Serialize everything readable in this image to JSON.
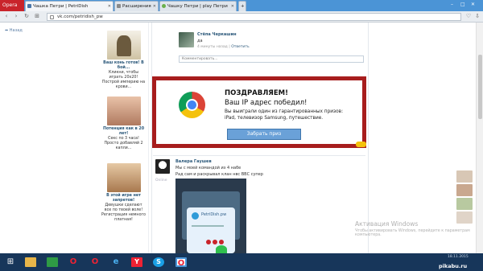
{
  "browser": {
    "opera_label": "Opera",
    "tabs": [
      {
        "label": "Чашка Петри | PetriDish"
      },
      {
        "label": "Расширения"
      },
      {
        "label": "Чашку Петри | play Петри"
      }
    ],
    "url": "vk.com/petridish_pw"
  },
  "sidebar": {
    "link": "Назад"
  },
  "ads": [
    {
      "title": "Ваш конь готов! В бой...",
      "text": "Кликни, чтобы играть 20x20! Построй империю на крови..."
    },
    {
      "title": "Потенция как в 20 лет!",
      "text": "Секс по 3 часа! Просто добавляй 2 капли..."
    },
    {
      "title": "В этой игре нет запретов!",
      "text": "Девушки сделают все по твоей воле! Регистрация немного платная!"
    }
  ],
  "comment": {
    "author": "Стёпа Черкашин",
    "text": "да",
    "time": "4 минуты назад",
    "reply": "Ответить",
    "placeholder": "Комментировать..."
  },
  "popup": {
    "heading": "ПОЗДРАВЛЯЕМ!",
    "subheading": "Ваш IP адрес победил!",
    "line1": "Вы выиграли один из гарантированных призов:",
    "line2": "iPad, телевизор Samsung, путешествие.",
    "button": "Забрать приз"
  },
  "post": {
    "author": "Валера Гаушев",
    "line1": "Мы с моей командой из 4 набе",
    "line2": "Рад сам и раскрывал клан нвс ВВС супер",
    "status": "Online",
    "card_title": "PetriDish.pw"
  },
  "watermark": {
    "title": "Активация Windows",
    "subtitle": "Чтобы активировать Windows, перейдите к параметрам компьютера."
  },
  "taskbar": {
    "date": "18.11.2015",
    "brand": "pikabu.ru"
  },
  "colors": {
    "accent": "#4a76a8",
    "popup_border": "#a71d1d",
    "button": "#6aa1d8",
    "taskbar": "#17365a"
  }
}
